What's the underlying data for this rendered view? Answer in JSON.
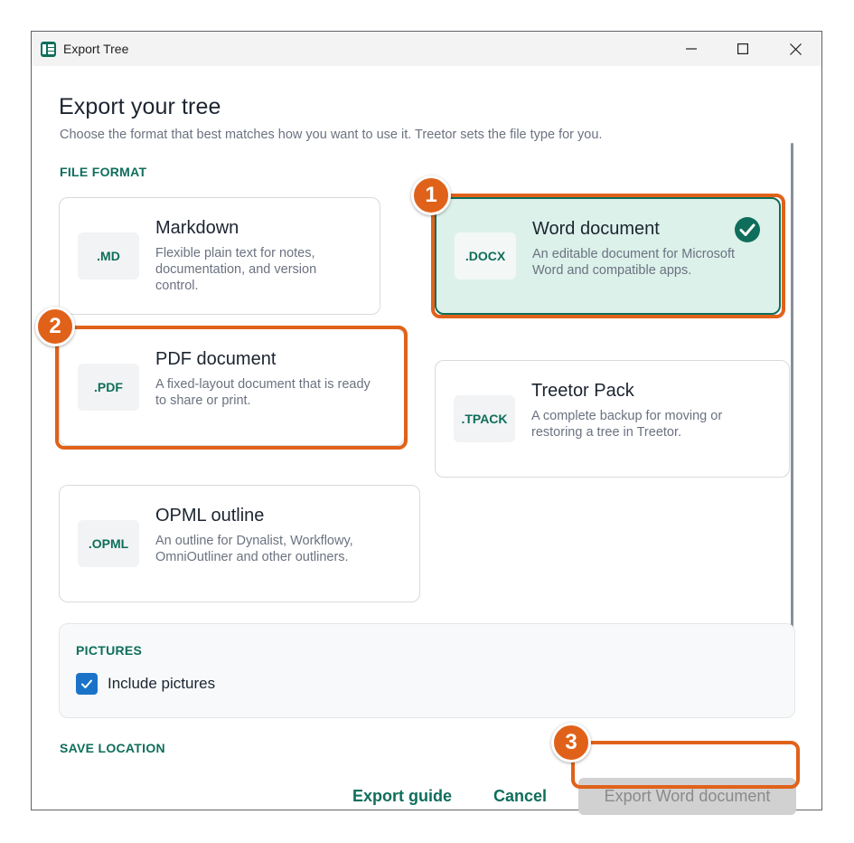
{
  "window": {
    "title": "Export Tree",
    "controls": [
      "minimize-icon",
      "maximize-icon",
      "close-icon"
    ]
  },
  "header": {
    "title": "Export your tree",
    "subtitle": "Choose the format that best matches how you want to use it. Treetor sets the file type for you."
  },
  "file_format": {
    "label": "FILE FORMAT",
    "options": [
      {
        "ext": ".MD",
        "title": "Markdown",
        "desc": "Flexible plain text for notes, documentation, and version control.",
        "selected": false
      },
      {
        "ext": ".DOCX",
        "title": "Word document",
        "desc": "An editable document for Microsoft Word and compatible apps.",
        "selected": true
      },
      {
        "ext": ".PDF",
        "title": "PDF document",
        "desc": "A fixed-layout document that is ready to share or print.",
        "selected": false
      },
      {
        "ext": ".TPACK",
        "title": "Treetor Pack",
        "desc": "A complete backup for moving or restoring a tree in Treetor.",
        "selected": false
      },
      {
        "ext": ".OPML",
        "title": "OPML outline",
        "desc": "An outline for Dynalist, Workflowy, OmniOutliner and other outliners.",
        "selected": false
      }
    ]
  },
  "pictures": {
    "label": "PICTURES",
    "include_label": "Include pictures",
    "checked": true
  },
  "save_location": {
    "label": "SAVE LOCATION"
  },
  "footer": {
    "guide_label": "Export guide",
    "cancel_label": "Cancel",
    "export_label": "Export Word document"
  },
  "annotations": {
    "badges": [
      "1",
      "2",
      "3"
    ]
  },
  "colors": {
    "accent": "#0f6e5b",
    "selected_bg": "#dcf1ea",
    "highlight": "#e0621a",
    "checkbox": "#1a73c9",
    "disabled_button": "#d1d1d1"
  }
}
